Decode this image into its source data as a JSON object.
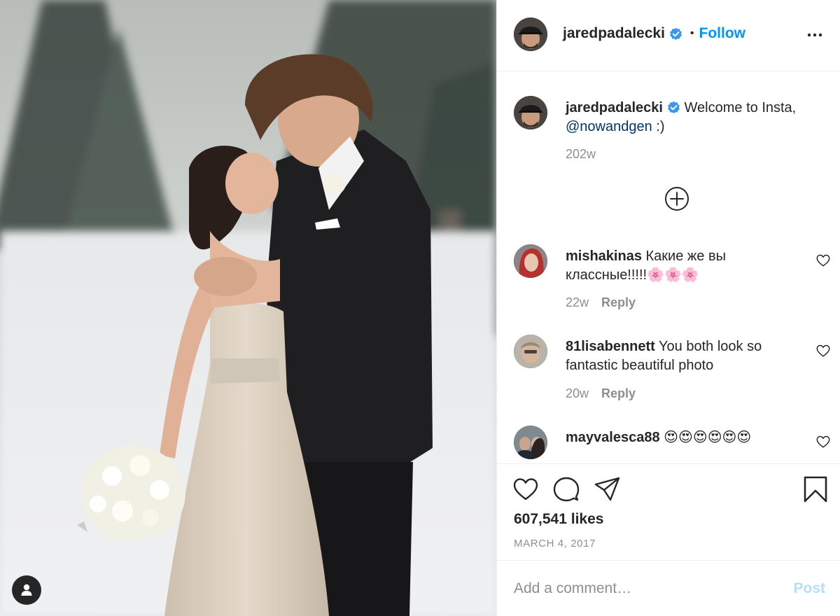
{
  "post": {
    "author": "jaredpadalecki",
    "follow_label": "Follow",
    "separator": "•",
    "caption": {
      "text": "Welcome to Insta,",
      "mention": "@nowandgen",
      "suffix": " :)",
      "age": "202w"
    },
    "comments": [
      {
        "username": "mishakinas",
        "text": "Какие же вы классные!!!!!🌸🌸🌸",
        "age": "22w",
        "reply_label": "Reply"
      },
      {
        "username": "81lisabennett",
        "text": "You both look so fantastic beautiful photo",
        "age": "20w",
        "reply_label": "Reply"
      },
      {
        "username": "mayvalesca88",
        "text": "😍😍😍😍😍😍"
      }
    ],
    "likes": "607,541 likes",
    "date": "MARCH 4, 2017",
    "comment_placeholder": "Add a comment…",
    "post_label": "Post"
  },
  "icons": {
    "verified": "verified-badge-icon",
    "more": "more-options-icon",
    "load_more": "plus-circle-icon",
    "like": "heart-icon",
    "comment": "comment-icon",
    "share": "share-icon",
    "save": "bookmark-icon",
    "user_tag": "user-icon"
  },
  "colors": {
    "accent": "#0095f6",
    "verified": "#3897f0",
    "mention": "#00376b",
    "muted": "#8e8e8e",
    "post_disabled": "#b2dffc"
  }
}
